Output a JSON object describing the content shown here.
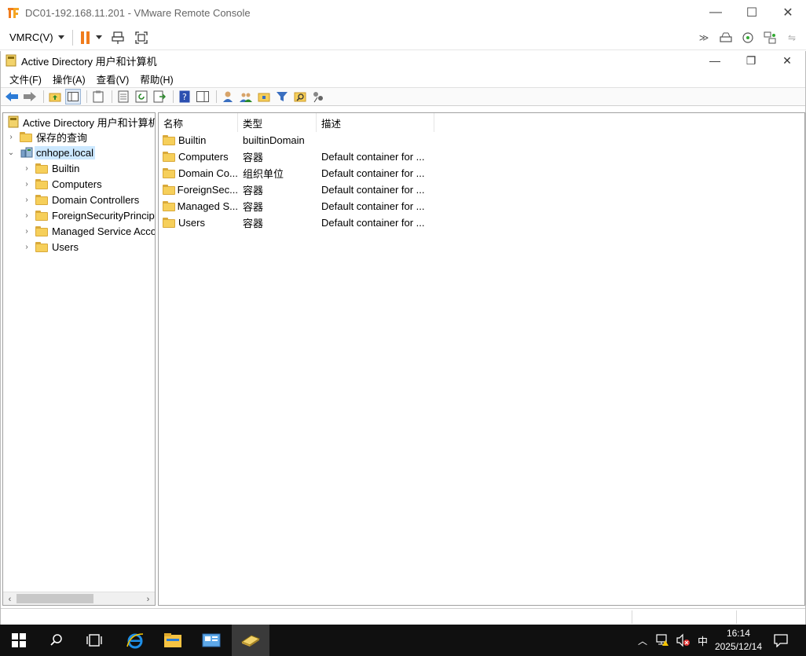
{
  "vmrc": {
    "title": "DC01-192.168.11.201 - VMware Remote Console",
    "menu_label": "VMRC(V)",
    "window_controls": {
      "minimize": "—",
      "maximize": "☐",
      "close": "✕"
    },
    "accent_color": "#f07c1c"
  },
  "ad_window": {
    "title": "Active Directory 用户和计算机",
    "controls": {
      "minimize": "—",
      "restore": "❐",
      "close": "✕"
    }
  },
  "menubar": [
    "文件(F)",
    "操作(A)",
    "查看(V)",
    "帮助(H)"
  ],
  "tree": {
    "root": "Active Directory 用户和计算机",
    "saved_queries": "保存的查询",
    "domain": "cnhope.local",
    "children": [
      "Builtin",
      "Computers",
      "Domain Controllers",
      "ForeignSecurityPrincipals",
      "Managed Service Accounts",
      "Users"
    ]
  },
  "list": {
    "columns": [
      "名称",
      "类型",
      "描述"
    ],
    "rows": [
      {
        "name": "Builtin",
        "type": "builtinDomain",
        "desc": ""
      },
      {
        "name": "Computers",
        "type": "容器",
        "desc": "Default container for ..."
      },
      {
        "name": "Domain Co...",
        "type": "组织单位",
        "desc": "Default container for ..."
      },
      {
        "name": "ForeignSec...",
        "type": "容器",
        "desc": "Default container for ..."
      },
      {
        "name": "Managed S...",
        "type": "容器",
        "desc": "Default container for ..."
      },
      {
        "name": "Users",
        "type": "容器",
        "desc": "Default container for ..."
      }
    ]
  },
  "taskbar": {
    "time": "16:14",
    "date": "2025/12/14",
    "ime": "中"
  }
}
